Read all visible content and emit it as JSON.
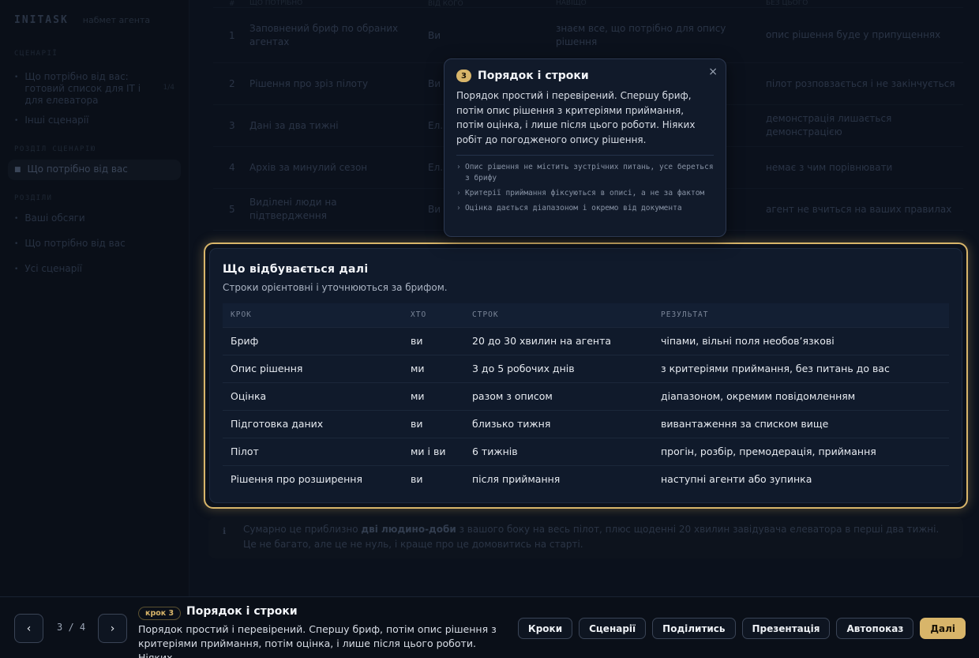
{
  "sidebar": {
    "brand": "INITASK",
    "brand_sub": "набмет агента",
    "sections": [
      {
        "title": "СЦЕНАРІЇ",
        "items": [
          {
            "label": "Що потрібно від вас: готовий список для IT і для елеватора",
            "count": "1/4"
          },
          {
            "label": "Інші сценарії"
          }
        ]
      },
      {
        "title": "РОЗДІЛ СЦЕНАРІЮ",
        "items": [
          {
            "label": "Що потрібно від вас",
            "active": true
          }
        ]
      },
      {
        "title": "РОЗДІЛИ",
        "items": [
          {
            "label": "Ваші обсяги"
          },
          {
            "label": "Що потрібно від вас"
          },
          {
            "label": "Усі сценарії"
          }
        ]
      }
    ]
  },
  "bg_table": {
    "header": [
      "#",
      "ЩО ПОТРІБНО",
      "ВІД КОГО",
      "НАВІЩО",
      "БЕЗ ЦЬОГО"
    ],
    "rows": [
      {
        "n": "1",
        "what": "Заповнений бриф по обраних агентах",
        "who": "Ви",
        "why": "знаєм все, що потрібно для опису рішення",
        "without": "опис рішення буде у припущеннях"
      },
      {
        "n": "2",
        "what": "Рішення про зріз пілоту",
        "who": "Ви",
        "why": "",
        "without": "пілот розповзається і не закінчується"
      },
      {
        "n": "3",
        "what": "Дані за два тижні",
        "who": "Ел...",
        "why": "",
        "without": "демонстрація лишається демонстрацією"
      },
      {
        "n": "4",
        "what": "Архів за минулий сезон",
        "who": "Ел...",
        "why": "",
        "without": "немає з чим порівнювати"
      },
      {
        "n": "5",
        "what": "Виділені люди на підтвердження",
        "who": "Ви",
        "why": "",
        "without": "агент не вчиться на ваших правилах"
      }
    ]
  },
  "card": {
    "title": "Що відбувається далі",
    "subtitle": "Строки орієнтовні і уточнюються за брифом.",
    "columns": [
      "КРОК",
      "ХТО",
      "СТРОК",
      "РЕЗУЛЬТАТ"
    ],
    "rows": [
      {
        "step": "Бриф",
        "who": "ви",
        "term": "20 до 30 хвилин на агента",
        "result": "чіпами, вільні поля необов’язкові"
      },
      {
        "step": "Опис рішення",
        "who": "ми",
        "term": "3 до 5 робочих днів",
        "result": "з критеріями приймання, без питань до вас"
      },
      {
        "step": "Оцінка",
        "who": "ми",
        "term": "разом з описом",
        "result": "діапазоном, окремим повідомленням"
      },
      {
        "step": "Підготовка даних",
        "who": "ви",
        "term": "близько тижня",
        "result": "вивантаження за списком вище"
      },
      {
        "step": "Пілот",
        "who": "ми і ви",
        "term": "6 тижнів",
        "result": "прогін, розбір, премодерація, приймання"
      },
      {
        "step": "Рішення про розширення",
        "who": "ви",
        "term": "після приймання",
        "result": "наступні агенти або зупинка"
      }
    ]
  },
  "note": {
    "icon": "info-icon",
    "before": "Сумарно це приблизно",
    "bold": "дві людино-доби",
    "after": "з вашого боку на весь пілот, плюс щоденні 20 хвилин завідувача елеватора в перші два тижні. Це не багато, але це не нуль, і краще про це домовитись на старті."
  },
  "popover": {
    "num": "3",
    "title": "Порядок і строки",
    "body": "Порядок простий і перевірений. Спершу бриф, потім опис рішення з критеріями приймання, потім оцінка, і лише після цього роботи. Ніяких робіт до погодженого опису рішення.",
    "bullets": [
      "Опис рішення не містить зустрічних питань, усе береться з брифу",
      "Критерії приймання фіксуються в описі, а не за фактом",
      "Оцінка дається діапазоном і окремо від документа"
    ],
    "close": "×"
  },
  "bottom": {
    "prev": "‹",
    "next": "›",
    "counter": "3 / 4",
    "step_pill": "крок 3",
    "step_title": "Порядок і строки",
    "step_desc": "Порядок простий і перевірений. Спершу бриф, потім опис рішення з критеріями приймання, потім оцінка, і лише після цього роботи. Ніяких...",
    "actions": [
      "Кроки",
      "Сценарії",
      "Поділитись",
      "Презентація",
      "Автопоказ",
      "Далі"
    ]
  },
  "colors": {
    "accent": "#d8b56a",
    "background": "#0b111c",
    "card": "#101a2b"
  }
}
